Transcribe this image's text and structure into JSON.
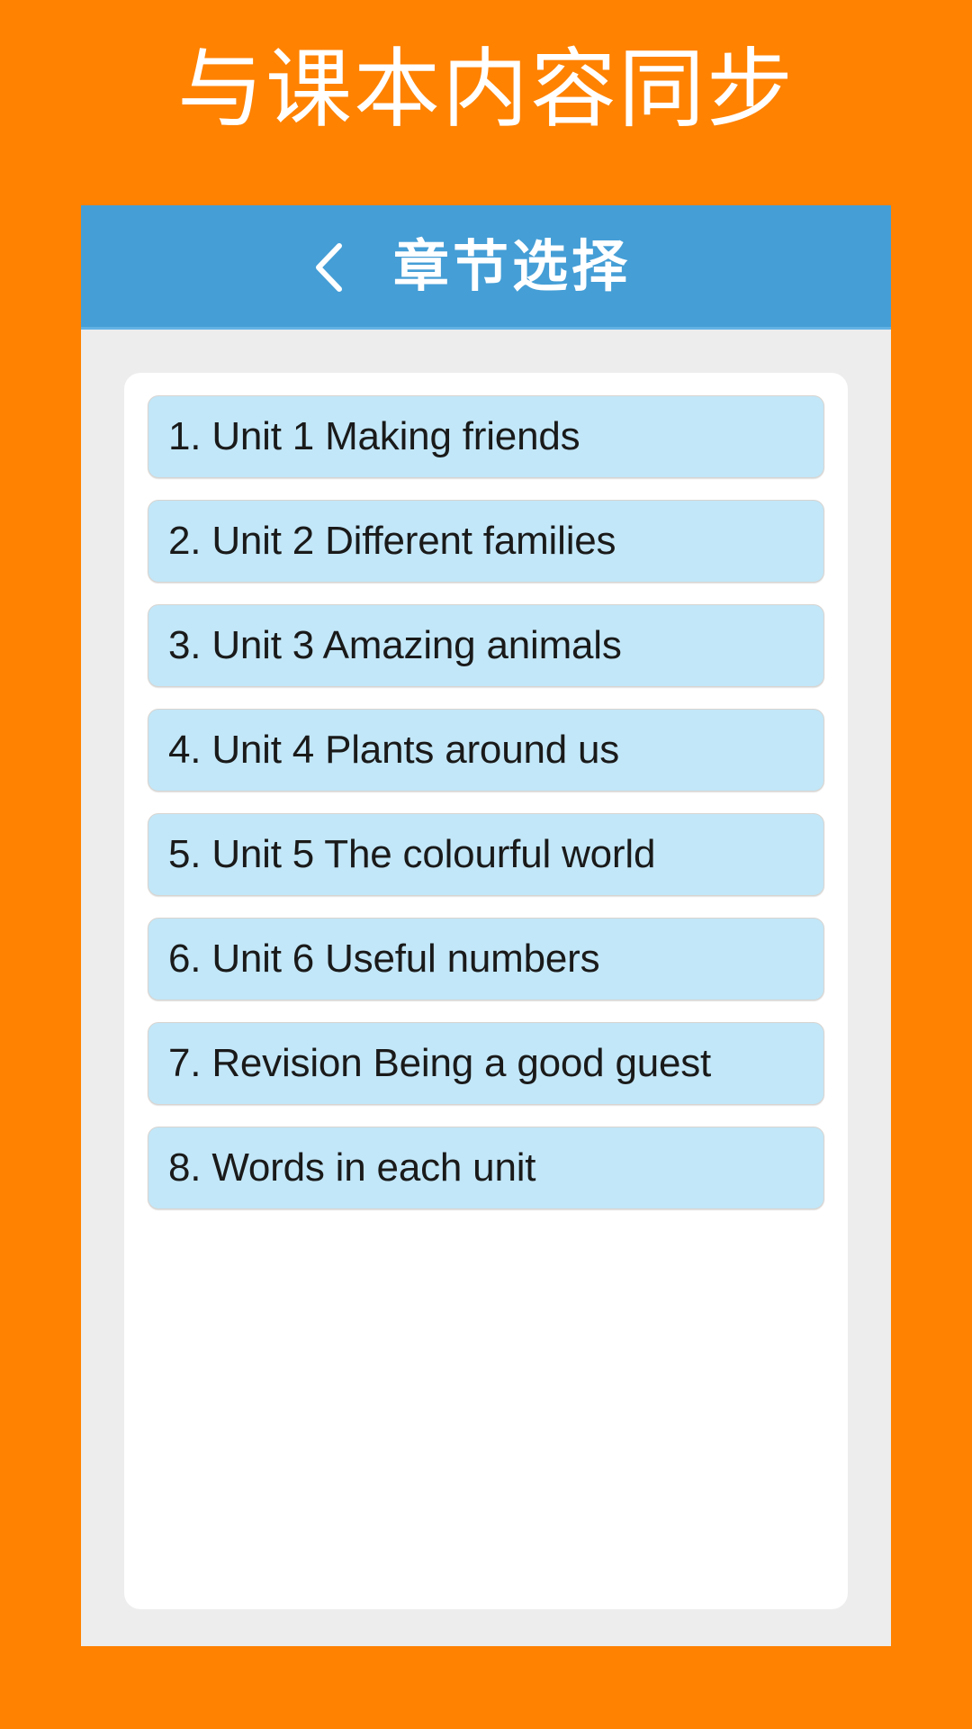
{
  "promo": {
    "headline": "与课本内容同步"
  },
  "app": {
    "appbar": {
      "back_icon": "chevron-left-icon",
      "title": "章节选择"
    },
    "chapter_list": [
      {
        "label": "1. Unit 1 Making friends"
      },
      {
        "label": "2. Unit 2 Different families"
      },
      {
        "label": "3. Unit 3 Amazing animals"
      },
      {
        "label": "4. Unit 4 Plants around us"
      },
      {
        "label": "5. Unit 5 The colourful world"
      },
      {
        "label": "6. Unit 6 Useful numbers"
      },
      {
        "label": "7. Revision Being a good guest"
      },
      {
        "label": "8. Words in each unit"
      }
    ]
  },
  "colors": {
    "background_orange": "#ff8200",
    "appbar_blue": "#459ed6",
    "item_blue": "#c2e7f8",
    "frame_gray": "#ededed",
    "card_white": "#ffffff",
    "item_text": "#1a1a1a"
  }
}
